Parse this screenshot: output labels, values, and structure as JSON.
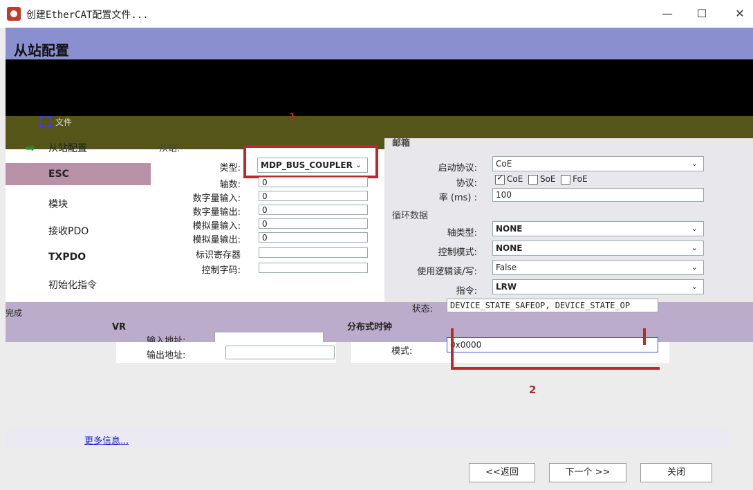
{
  "window": {
    "title": "创建EtherCAT配置文件...",
    "minimize": "—",
    "maximize": "☐",
    "close": "✕"
  },
  "header": {
    "title": "从站配置"
  },
  "toolbar": {
    "files_label": "文件",
    "marker_1": "1"
  },
  "nav": {
    "items": [
      {
        "label": "从站配置",
        "selected": true
      },
      {
        "label": "ESC"
      },
      {
        "label": "模块"
      },
      {
        "label": "接收PDO"
      },
      {
        "label": "TXPDO"
      },
      {
        "label": "初始化指令"
      }
    ],
    "finish_label": "完成"
  },
  "slave": {
    "section_label": "从站:",
    "type_label": "类型:",
    "type_value": "MDP_BUS_COUPLER",
    "axes_label": "轴数:",
    "axes_value": "0",
    "digital_in_label": "数字量输入:",
    "digital_in_value": "0",
    "digital_out_label": "数字量输出:",
    "digital_out_value": "0",
    "analog_in_label": "模拟量输入:",
    "analog_in_value": "0",
    "analog_out_label": "模拟量输出:",
    "analog_out_value": "0",
    "id_reg_label": "标识寄存器",
    "id_reg_value": "",
    "ctrl_word_label": "控制字码:",
    "ctrl_word_value": ""
  },
  "mailbox": {
    "section_label": "邮箱",
    "start_proto_label": "启动协议:",
    "start_proto_value": "CoE",
    "proto_label": "协议:",
    "coe": "CoE",
    "soe": "SoE",
    "foe": "FoE",
    "rate_label": "率 (ms) :",
    "rate_value": "100"
  },
  "cyclic": {
    "section_label": "循环数据",
    "axis_type_label": "轴类型:",
    "axis_type_value": "NONE",
    "ctrl_mode_label": "控制模式:",
    "ctrl_mode_value": "NONE",
    "logic_rw_label": "使用逻辑读/写:",
    "logic_rw_value": "False",
    "cmd_label": "指令:",
    "cmd_value": "LRW",
    "state_label": "状态:",
    "state_value": "DEVICE_STATE_SAFEOP, DEVICE_STATE_OP"
  },
  "vr": {
    "section_label": "VR",
    "input_addr_label": "输入地址:",
    "input_addr_value": "",
    "output_addr_label": "输出地址:",
    "output_addr_value": ""
  },
  "dc": {
    "section_label": "分布式时钟",
    "mode_label": "模式:",
    "mode_value": "0x0000",
    "marker_2": "2"
  },
  "footer": {
    "more_info": "更多信息...",
    "back": "<<返回",
    "next": "下一个 >>",
    "close": "关闭"
  }
}
